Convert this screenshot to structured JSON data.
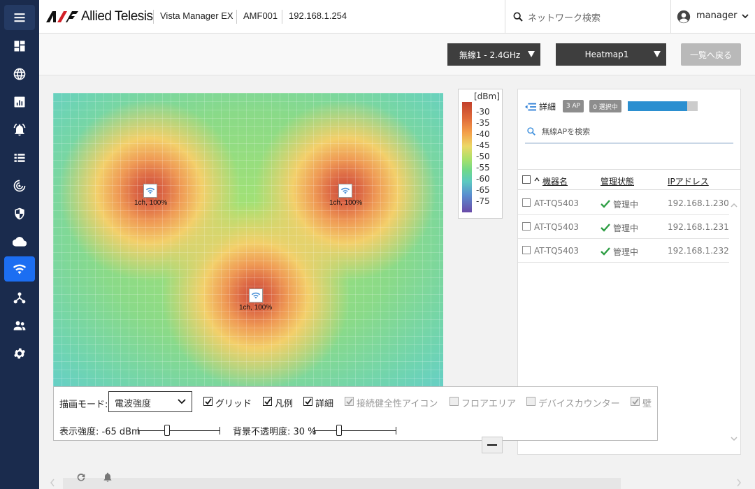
{
  "header": {
    "brand": "Allied Telesis",
    "product": "Vista Manager EX",
    "device": "AMF001",
    "ip": "192.168.1.254",
    "search_placeholder": "ネットワーク検索",
    "user": "manager"
  },
  "nav": {
    "icons": [
      "menu-icon",
      "dashboard-icon",
      "globe-icon",
      "chart-icon",
      "alarm-icon",
      "list-icon",
      "radar-icon",
      "shield-icon",
      "cloud-icon",
      "wifi-icon",
      "topology-icon",
      "users-icon",
      "gear-icon"
    ],
    "active": "wifi-icon"
  },
  "toolbar": {
    "band": "無線1 - 2.4GHz",
    "heatmap": "Heatmap1",
    "back_label": "一覧へ戻る"
  },
  "legend": {
    "unit": "[dBm]",
    "ticks": [
      "-30",
      "-35",
      "-40",
      "-45",
      "-50",
      "-55",
      "-60",
      "-65",
      "-75"
    ]
  },
  "heatmap": {
    "aps": [
      {
        "label": "1ch, 100%"
      },
      {
        "label": "1ch, 100%"
      },
      {
        "label": "1ch, 100%"
      }
    ]
  },
  "panel": {
    "detail_label": "詳細",
    "ap_count_badge": "3 AP",
    "selected_badge": "0 選択中",
    "progress_fraction": 0.85,
    "search_placeholder": "無線APを検索",
    "columns": [
      "機器名",
      "管理状態",
      "IPアドレス"
    ],
    "rows": [
      {
        "name": "AT-TQ5403",
        "status": "管理中",
        "ip": "192.168.1.230"
      },
      {
        "name": "AT-TQ5403",
        "status": "管理中",
        "ip": "192.168.1.231"
      },
      {
        "name": "AT-TQ5403",
        "status": "管理中",
        "ip": "192.168.1.232"
      }
    ]
  },
  "controls": {
    "mode_label": "描画モード:",
    "mode_value": "電波強度",
    "grid_label": "グリッド",
    "legend_label": "凡例",
    "detail_label": "詳細",
    "connection_label": "接続健全性アイコン",
    "floor_label": "フロアエリア",
    "device_counter_label": "デバイスカウンター",
    "wall_label": "壁",
    "strength_label": "表示強度: -65 dBm",
    "opacity_label": "背景不透明度: 30 %"
  },
  "colors": {
    "nav_bg": "#1a2b4d",
    "nav_active": "#1c6ef2",
    "status_ok": "#2e9e44",
    "progress": "#2b8fd0"
  }
}
